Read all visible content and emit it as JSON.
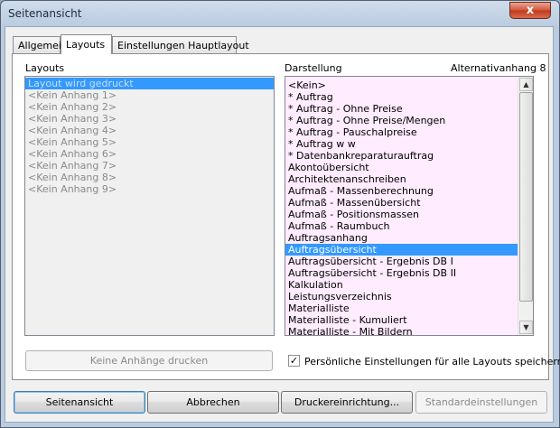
{
  "window": {
    "title": "Seitenansicht",
    "close_glyph": "x"
  },
  "tabs": [
    {
      "label": "Allgemein"
    },
    {
      "label": "Layouts"
    },
    {
      "label": "Einstellungen Hauptlayout"
    }
  ],
  "layouts": {
    "label": "Layouts",
    "items": [
      "Layout wird gedruckt",
      "<Kein Anhang 1>",
      "<Kein Anhang 2>",
      "<Kein Anhang 3>",
      "<Kein Anhang 4>",
      "<Kein Anhang 5>",
      "<Kein Anhang 6>",
      "<Kein Anhang 7>",
      "<Kein Anhang 8>",
      "<Kein Anhang 9>"
    ],
    "selected_index": 0
  },
  "darstellung": {
    "label": "Darstellung",
    "info": "Alternativanhang 8",
    "items": [
      "<Kein>",
      "* Auftrag",
      "* Auftrag - Ohne Preise",
      "* Auftrag - Ohne Preise/Mengen",
      "* Auftrag - Pauschalpreise",
      "* Auftrag w w",
      "* Datenbankreparaturauftrag",
      "Akontoübersicht",
      "Architektenanschreiben",
      "Aufmaß - Massenberechnung",
      "Aufmaß - Massenübersicht",
      "Aufmaß - Positionsmassen",
      "Aufmaß - Raumbuch",
      "Auftragsanhang",
      "Auftragsübersicht",
      "Auftragsübersicht - Ergebnis DB I",
      "Auftragsübersicht - Ergebnis DB II",
      "Kalkulation",
      "Leistungsverzeichnis",
      "Materialliste",
      "Materialliste - Kumuliert",
      "Materialliste - Mit Bildern"
    ],
    "selected_index": 14,
    "background_color": "#ffecff"
  },
  "keine_anhaenge_button": "Keine Anhänge drucken",
  "persoenlich_checkbox": {
    "label": "Persönliche Einstellungen für alle Layouts speichern",
    "checked": true,
    "mark": "✓"
  },
  "buttons": {
    "seitenansicht": "Seitenansicht",
    "abbrechen": "Abbrechen",
    "druckereinrichtung": "Druckereinrichtung...",
    "standardeinstellungen": "Standardeinstellungen"
  },
  "scroll": {
    "up_glyph": "▲",
    "down_glyph": "▼"
  },
  "colors": {
    "selection": "#3399ff",
    "list_background": "#ffecff",
    "titlebar": "#b9cbe0"
  }
}
